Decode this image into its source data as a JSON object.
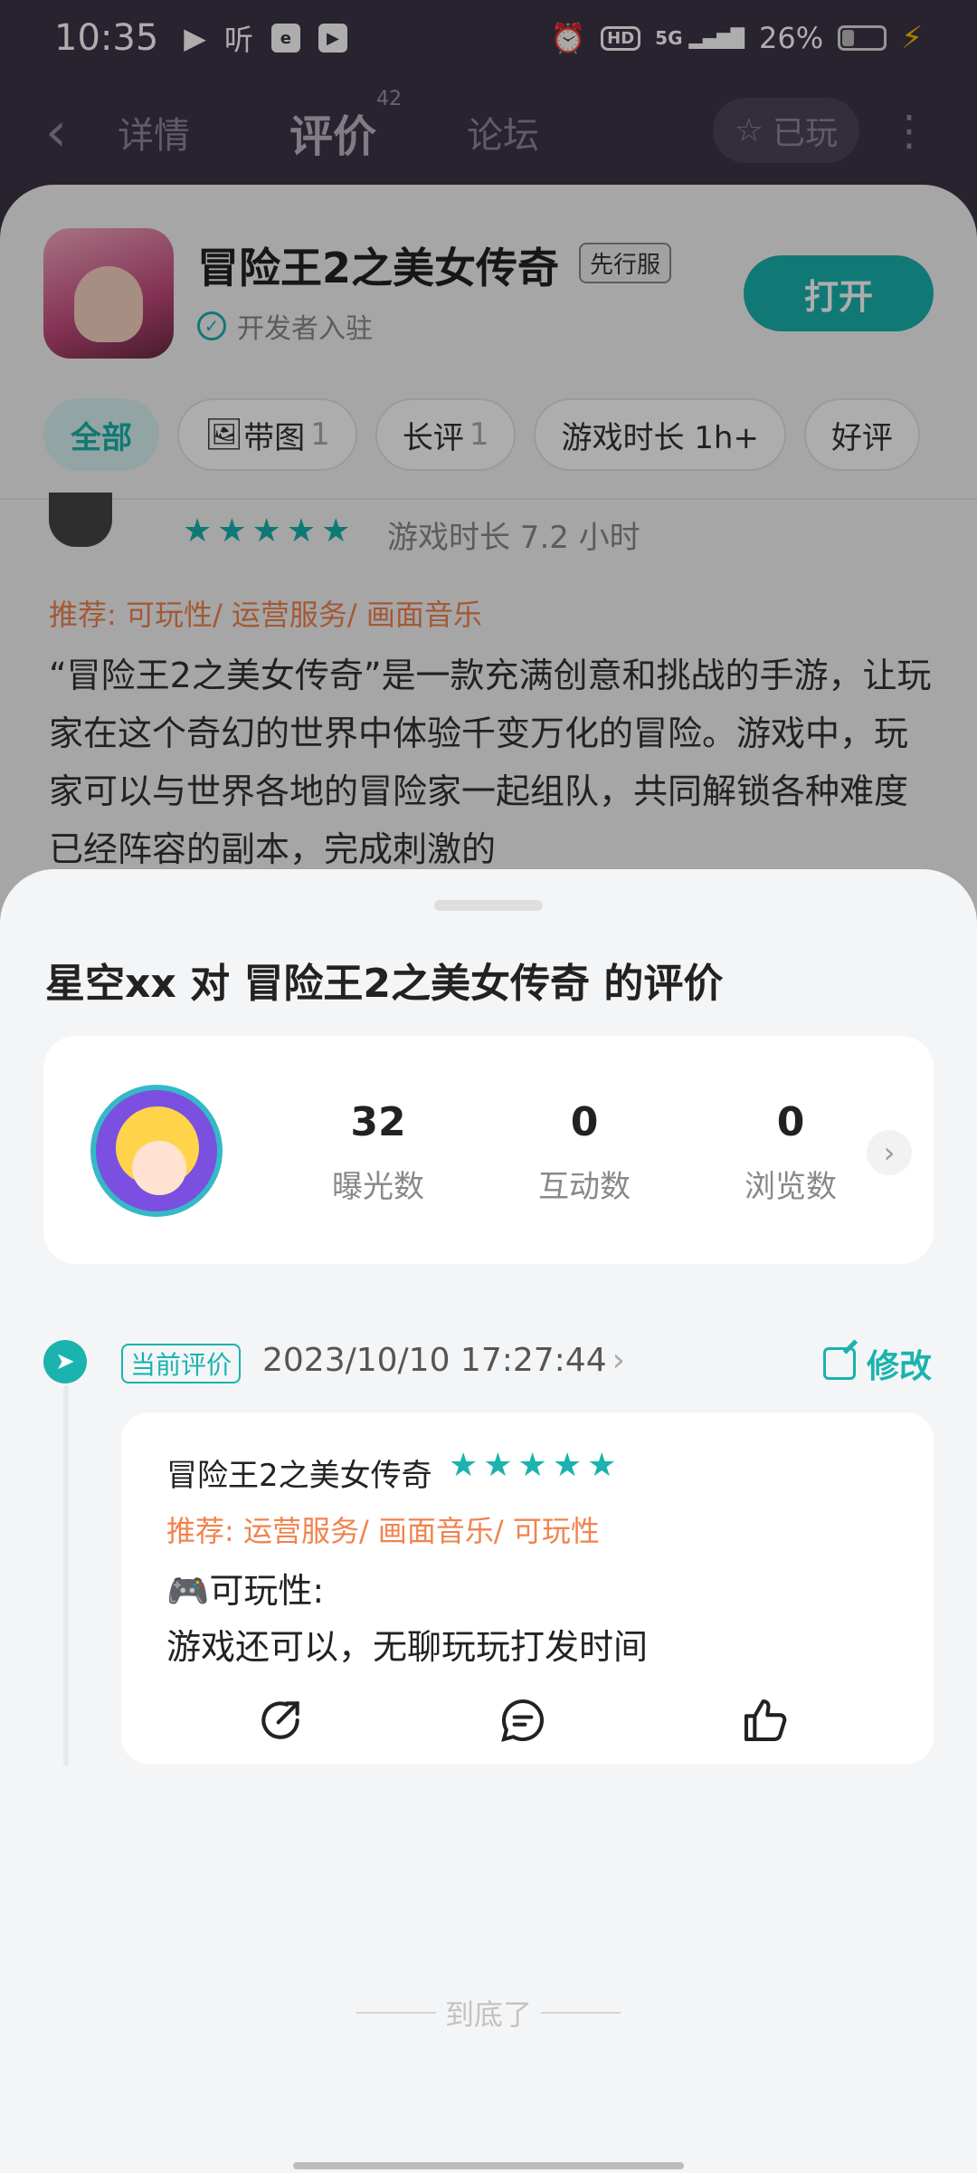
{
  "status_bar": {
    "time": "10:35",
    "app_icons": [
      "▶",
      "听"
    ],
    "battery": "26%",
    "hd": "HD",
    "network": "5G"
  },
  "nav": {
    "tabs": [
      "详情",
      "评价",
      "论坛"
    ],
    "review_count": "42",
    "played_label": "已玩"
  },
  "app": {
    "name": "冒险王2之美女传奇",
    "badge": "先行服",
    "dev_label": "开发者入驻",
    "open_button": "打开"
  },
  "filters": [
    {
      "label": "全部",
      "count": ""
    },
    {
      "label": "带图",
      "count": "1"
    },
    {
      "label": "长评",
      "count": "1"
    },
    {
      "label": "游戏时长 1h+",
      "count": ""
    },
    {
      "label": "好评",
      "count": ""
    }
  ],
  "background_review": {
    "play_time": "游戏时长 7.2 小时",
    "recommend": "推荐: 可玩性/ 运营服务/ 画面音乐",
    "text": "“冒险王2之美女传奇”是一款充满创意和挑战的手游，让玩家在这个奇幻的世界中体验千变万化的冒险。游戏中，玩家可以与世界各地的冒险家一起组队，共同解锁各种难度已经阵容的副本，完成刺激的"
  },
  "sheet": {
    "title": "星空xx 对 冒险王2之美女传奇 的评价",
    "stats": [
      {
        "value": "32",
        "label": "曝光数"
      },
      {
        "value": "0",
        "label": "互动数"
      },
      {
        "value": "0",
        "label": "浏览数"
      }
    ],
    "current_tag": "当前评价",
    "datetime": "2023/10/10 17:27:44",
    "edit_label": "修改",
    "review": {
      "game": "冒险王2之美女传奇",
      "rating": 5,
      "recommend": "推荐: 运营服务/ 画面音乐/ 可玩性",
      "line1": "🎮可玩性:",
      "line2": "游戏还可以，无聊玩玩打发时间"
    },
    "end_text": "到底了"
  },
  "colors": {
    "accent": "#1ab3ad",
    "recommend": "#f0834f",
    "nav_bg": "#3b3446"
  }
}
